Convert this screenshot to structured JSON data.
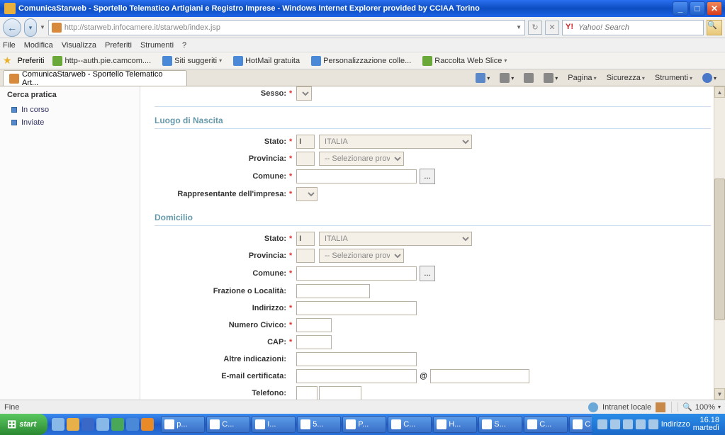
{
  "title": "ComunicaStarweb - Sportello Telematico Artigiani e Registro Imprese - Windows Internet Explorer provided by CCIAA Torino",
  "url": "http://starweb.infocamere.it/starweb/index.jsp",
  "search_placeholder": "Yahoo! Search",
  "menu": [
    "File",
    "Modifica",
    "Visualizza",
    "Preferiti",
    "Strumenti",
    "?"
  ],
  "fav_label": "Preferiti",
  "fav_items": [
    "http--auth.pie.camcom....",
    "Siti suggeriti",
    "HotMail gratuita",
    "Personalizzazione colle...",
    "Raccolta Web Slice"
  ],
  "tab_label": "ComunicaStarweb - Sportello Telematico Art...",
  "page_menu": {
    "pagina": "Pagina",
    "sicurezza": "Sicurezza",
    "strumenti": "Strumenti"
  },
  "sidebar": {
    "title": "Cerca pratica",
    "items": [
      "In corso",
      "Inviate"
    ]
  },
  "form": {
    "sections": {
      "luogo": "Luogo di Nascita",
      "domicilio": "Domicilio"
    },
    "labels": {
      "sesso": "Sesso:",
      "stato": "Stato:",
      "provincia": "Provincia:",
      "comune": "Comune:",
      "rapp": "Rappresentante dell'impresa:",
      "frazione": "Frazione o Località:",
      "indirizzo": "Indirizzo:",
      "civico": "Numero Civico:",
      "cap": "CAP:",
      "altre": "Altre indicazioni:",
      "email": "E-mail certificata:",
      "telefono": "Telefono:"
    },
    "stato_code": "I",
    "stato_name": "ITALIA",
    "prov_placeholder": "-- Selezionare prov. --",
    "lookup": "...",
    "at": "@"
  },
  "status": {
    "fine": "Fine",
    "intranet": "Intranet locale",
    "zoom": "100%"
  },
  "taskbar": {
    "start": "start",
    "buttons": [
      "p...",
      "C...",
      "I...",
      "5...",
      "P...",
      "C...",
      "H...",
      "S...",
      "C...",
      "C I..."
    ],
    "tray": {
      "indirizzo": "Indirizzo",
      "time": "16.18",
      "day": "martedì"
    }
  }
}
